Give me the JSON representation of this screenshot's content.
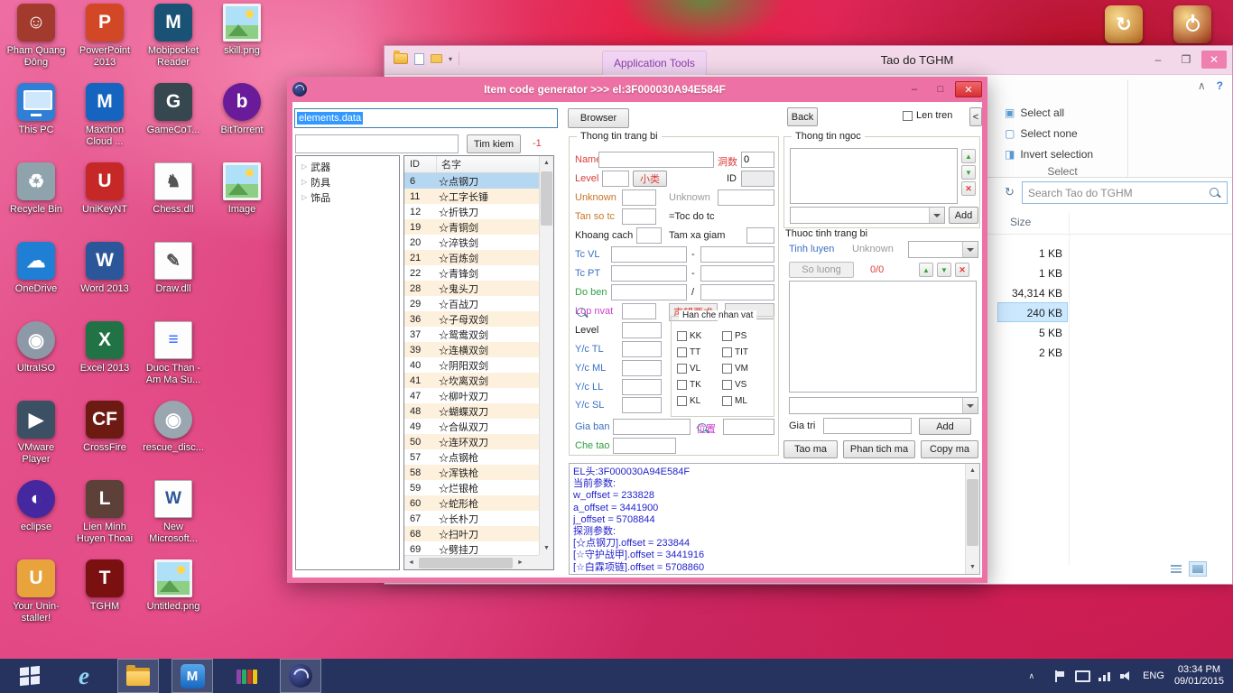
{
  "icons": {
    "minimize": "–",
    "maximize": "□",
    "restore": "❐",
    "close": "✕",
    "collapse_ribbon": "∧",
    "help": "?",
    "select_all": "▣",
    "select_none": "▢",
    "invert_selection": "◨",
    "refresh": "↻",
    "tree_collapsed": "▷",
    "scroll_up": "▲",
    "scroll_down": "▼",
    "scroll_left": "◄",
    "scroll_right": "►",
    "arrow_up": "▲",
    "arrow_down": "▼",
    "delete": "✕",
    "qat_dropdown": "▾"
  },
  "desktop": {
    "columns": [
      {
        "icons": [
          {
            "label": "Pham Quang Đông",
            "name": "pham-quang-dong",
            "type": "letter",
            "glyph": "☺",
            "color": "#a33a2e"
          },
          {
            "label": "This PC",
            "name": "this-pc",
            "type": "monitor",
            "glyph": "",
            "color": "#2f7fd6"
          },
          {
            "label": "Recycle Bin",
            "name": "recycle-bin",
            "type": "letter",
            "glyph": "♻",
            "color": "#8fa3ad"
          },
          {
            "label": "OneDrive",
            "name": "onedrive",
            "type": "letter",
            "glyph": "☁",
            "color": "#1f7fd4"
          },
          {
            "label": "UltraISO",
            "name": "ultraiso",
            "type": "circle",
            "glyph": "◉",
            "color": "#8d99a6"
          },
          {
            "label": "VMware Player",
            "name": "vmware-player",
            "type": "letter",
            "glyph": "▶",
            "color": "#3b5063"
          },
          {
            "label": "eclipse",
            "name": "eclipse",
            "type": "circle",
            "glyph": "◐",
            "color": "#4527a0"
          },
          {
            "label": "Your Unin-staller!",
            "name": "your-uninstaller",
            "type": "letter",
            "glyph": "U",
            "color": "#e8a33d"
          }
        ]
      },
      {
        "icons": [
          {
            "label": "PowerPoint 2013",
            "name": "powerpoint-2013",
            "type": "letter",
            "glyph": "P",
            "color": "#d24726"
          },
          {
            "label": "Maxthon Cloud ...",
            "name": "maxthon-cloud",
            "type": "letter",
            "glyph": "M",
            "color": "#1565c0"
          },
          {
            "label": "UniKeyNT",
            "name": "unikeynt",
            "type": "letter",
            "glyph": "U",
            "color": "#c62828"
          },
          {
            "label": "Word 2013",
            "name": "word-2013",
            "type": "letter",
            "glyph": "W",
            "color": "#2b579a"
          },
          {
            "label": "Excel 2013",
            "name": "excel-2013",
            "type": "letter",
            "glyph": "X",
            "color": "#217346"
          },
          {
            "label": "CrossFire",
            "name": "crossfire",
            "type": "letter",
            "glyph": "CF",
            "color": "#6d1a12"
          },
          {
            "label": "Lien Minh Huyen Thoai",
            "name": "lien-minh-huyen-thoai",
            "type": "letter",
            "glyph": "L",
            "color": "#5d4037"
          },
          {
            "label": "TGHM",
            "name": "tghm",
            "type": "letter",
            "glyph": "T",
            "color": "#7b1010"
          }
        ]
      },
      {
        "icons": [
          {
            "label": "Mobipocket Reader",
            "name": "mobipocket-reader",
            "type": "letter",
            "glyph": "M",
            "color": "#1a5276"
          },
          {
            "label": "GameCoT...",
            "name": "gamecot",
            "type": "letter",
            "glyph": "G",
            "color": "#37474f"
          },
          {
            "label": "Chess.dll",
            "name": "chess-dll",
            "type": "doc",
            "glyph": "♞",
            "color": "#555555"
          },
          {
            "label": "Draw.dll",
            "name": "draw-dll",
            "type": "doc",
            "glyph": "✎",
            "color": "#555555"
          },
          {
            "label": "Duoc Than - Am Ma Su...",
            "name": "duoc-than-am-ma-su",
            "type": "doc",
            "glyph": "≡",
            "color": "#2962ff"
          },
          {
            "label": "rescue_disc...",
            "name": "rescue-disc",
            "type": "circle",
            "glyph": "◉",
            "color": "#9aa7b0"
          },
          {
            "label": "New Microsoft...",
            "name": "new-microsoft-doc",
            "type": "doc",
            "glyph": "W",
            "color": "#2b579a"
          },
          {
            "label": "Untitled.png",
            "name": "untitled-png",
            "type": "image",
            "glyph": "",
            "color": "#90caf9"
          }
        ]
      },
      {
        "icons": [
          {
            "label": "skill.png",
            "name": "skill-png",
            "type": "image",
            "glyph": "",
            "color": "#80cbc4"
          },
          {
            "label": "BitTorrent",
            "name": "bittorrent",
            "type": "circle",
            "glyph": "b",
            "color": "#6a1b9a"
          },
          {
            "label": "Image",
            "name": "image-folder",
            "type": "image",
            "glyph": "",
            "color": "#64b5f6"
          }
        ]
      }
    ],
    "power": [
      {
        "label": "restart",
        "name": "restart",
        "color": "#b5691e"
      },
      {
        "label": "shutdown",
        "name": "shutdown",
        "color": "#9c2f14"
      }
    ]
  },
  "explorer": {
    "title": "Tao do TGHM",
    "ribbon_tab": "Application Tools",
    "select_all": "Select all",
    "select_none": "Select none",
    "invert_selection": "Invert selection",
    "select_caption": "Select",
    "search_placeholder": "Search Tao do TGHM",
    "size_header": "Size",
    "files": [
      {
        "size": "1 KB",
        "selected": false
      },
      {
        "size": "1 KB",
        "selected": false
      },
      {
        "size": "34,314 KB",
        "selected": false
      },
      {
        "size": "240 KB",
        "selected": true
      },
      {
        "size": "5 KB",
        "selected": false
      },
      {
        "size": "2 KB",
        "selected": false
      }
    ]
  },
  "app": {
    "title": "Item code generator >>> el:3F000030A94E584F",
    "toolbar": {
      "file_path": "elements.data",
      "browser": "Browser",
      "back": "Back",
      "len_tren": "Len tren",
      "collapse": "<",
      "tim_kiem": "Tim kiem",
      "result_count": "-1"
    },
    "tree": {
      "items": [
        "武器",
        "防具",
        "饰品"
      ]
    },
    "table": {
      "headers": [
        "ID",
        "名字"
      ],
      "selected_index": 0,
      "rows": [
        [
          "6",
          "☆点钢刀"
        ],
        [
          "11",
          "☆工字长锤"
        ],
        [
          "12",
          "☆折铁刀"
        ],
        [
          "19",
          "☆青铜剑"
        ],
        [
          "20",
          "☆淬铁剑"
        ],
        [
          "21",
          "☆百炼剑"
        ],
        [
          "22",
          "☆青锋剑"
        ],
        [
          "28",
          "☆鬼头刀"
        ],
        [
          "29",
          "☆百战刀"
        ],
        [
          "36",
          "☆子母双剑"
        ],
        [
          "37",
          "☆鸳鸯双剑"
        ],
        [
          "39",
          "☆连横双剑"
        ],
        [
          "40",
          "☆阴阳双剑"
        ],
        [
          "41",
          "☆坎离双剑"
        ],
        [
          "47",
          "☆柳叶双刀"
        ],
        [
          "48",
          "☆蝴蝶双刀"
        ],
        [
          "49",
          "☆合纵双刀"
        ],
        [
          "50",
          "☆连环双刀"
        ],
        [
          "57",
          "☆点钢枪"
        ],
        [
          "58",
          "☆浑铁枪"
        ],
        [
          "59",
          "☆烂银枪"
        ],
        [
          "60",
          "☆蛇形枪"
        ],
        [
          "67",
          "☆长朴刀"
        ],
        [
          "68",
          "☆扫叶刀"
        ],
        [
          "69",
          "☆劈挂刀"
        ]
      ]
    },
    "equip": {
      "title": "Thong tin trang bi",
      "name_label": "Name",
      "hole_label": "洞数",
      "hole_value": "0",
      "level_label": "Level",
      "subcat_button": "小类",
      "id_label": "ID",
      "unknown1_label": "Unknown",
      "unknown2_label": "Unknown",
      "tanso_label": "Tan so tc",
      "tocdo_label": "=Toc do tc",
      "khoangcach_label": "Khoang cach",
      "tamxa_label": "Tam xa giam",
      "tcvl_label": "Tc VL",
      "tcpt_label": "Tc PT",
      "doben_label": "Do ben",
      "lopnvat_label": "Lop nvat",
      "reputation_label": "声望要求",
      "level2_label": "Level",
      "restrict_title": "Han che nhan vat",
      "restrict_options": [
        "KK",
        "PS",
        "TT",
        "TIT",
        "VL",
        "VM",
        "TK",
        "VS",
        "KL",
        "ML"
      ],
      "yc_labels": [
        "Y/c TL",
        "Y/c ML",
        "Y/c LL",
        "Y/c SL"
      ],
      "giaban_label": "Gia ban",
      "vitri_label": "位置",
      "chetao_label": "Che tao",
      "dash": "-",
      "slash": "/"
    },
    "gem": {
      "title": "Thong tin ngoc",
      "add": "Add"
    },
    "attrs": {
      "title": "Thuoc tinh trang bi",
      "tinh_luyen": "Tinh luyen",
      "unknown": "Unknown",
      "so_luong": "So luong",
      "count": "0/0",
      "gia_tri": "Gia tri",
      "add": "Add",
      "tao_ma": "Tao ma",
      "phan_tich_ma": "Phan tich ma",
      "copy_ma": "Copy ma"
    },
    "output": {
      "lines": [
        "EL头:3F000030A94E584F",
        "当前参数:",
        "w_offset = 233828",
        "a_offset = 3441900",
        "j_offset = 5708844",
        "探测参数:",
        "[☆点钢刀].offset = 233844",
        "[☆守护战甲].offset = 3441916",
        "[☆白霖项链].offset = 5708860"
      ]
    }
  },
  "taskbar": {
    "language": "ENG",
    "time": "03:34 PM",
    "date": "09/01/2015",
    "buttons": [
      {
        "name": "start",
        "active": false
      },
      {
        "name": "internet-explorer",
        "active": false
      },
      {
        "name": "file-explorer",
        "active": true
      },
      {
        "name": "maxthon",
        "active": true
      },
      {
        "name": "winrar",
        "active": false
      },
      {
        "name": "item-generator",
        "active": true
      }
    ],
    "tray_icons": [
      "hidden-icons",
      "flag",
      "monitor",
      "network",
      "volume"
    ]
  }
}
